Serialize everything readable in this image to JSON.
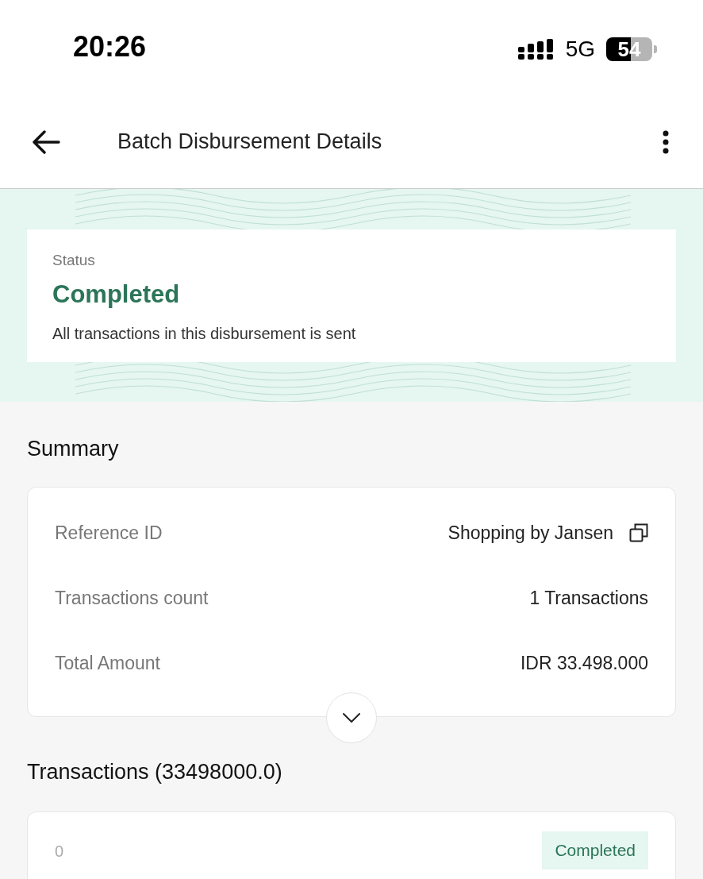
{
  "status_bar": {
    "time": "20:26",
    "network": "5G",
    "battery": "54"
  },
  "header": {
    "title": "Batch Disbursement Details"
  },
  "status_card": {
    "label": "Status",
    "value": "Completed",
    "description": "All transactions in this disbursement is sent"
  },
  "summary": {
    "title": "Summary",
    "expanded": false,
    "rows": [
      {
        "label": "Reference ID",
        "value": "Shopping by Jansen",
        "copyable": true
      },
      {
        "label": "Transactions count",
        "value": "1 Transactions",
        "copyable": false
      },
      {
        "label": "Total Amount",
        "value": "IDR 33.498.000",
        "copyable": false
      }
    ]
  },
  "transactions": {
    "title": "Transactions (33498000.0)",
    "items": [
      {
        "id": "0",
        "status": "Completed"
      }
    ]
  }
}
